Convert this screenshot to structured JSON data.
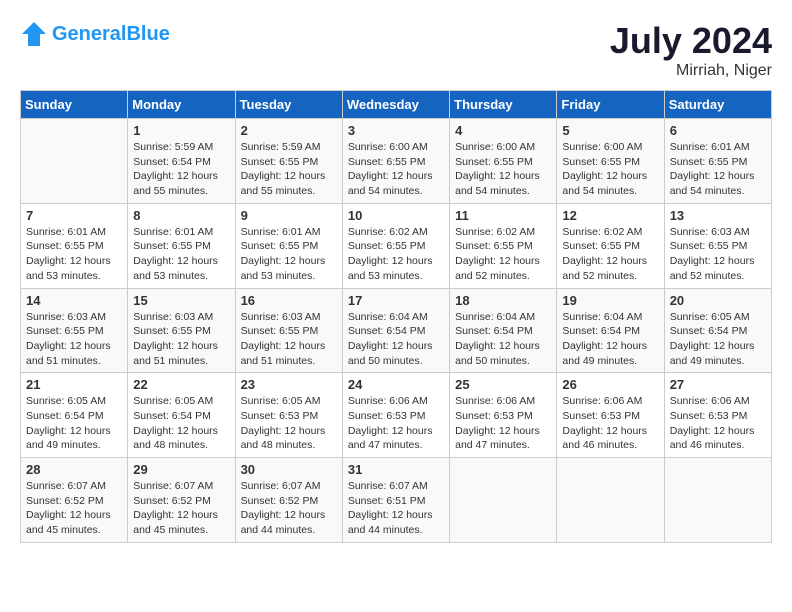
{
  "header": {
    "logo_text_general": "General",
    "logo_text_blue": "Blue",
    "month_year": "July 2024",
    "location": "Mirriah, Niger"
  },
  "weekdays": [
    "Sunday",
    "Monday",
    "Tuesday",
    "Wednesday",
    "Thursday",
    "Friday",
    "Saturday"
  ],
  "weeks": [
    [
      {
        "day": "",
        "info": ""
      },
      {
        "day": "1",
        "info": "Sunrise: 5:59 AM\nSunset: 6:54 PM\nDaylight: 12 hours\nand 55 minutes."
      },
      {
        "day": "2",
        "info": "Sunrise: 5:59 AM\nSunset: 6:55 PM\nDaylight: 12 hours\nand 55 minutes."
      },
      {
        "day": "3",
        "info": "Sunrise: 6:00 AM\nSunset: 6:55 PM\nDaylight: 12 hours\nand 54 minutes."
      },
      {
        "day": "4",
        "info": "Sunrise: 6:00 AM\nSunset: 6:55 PM\nDaylight: 12 hours\nand 54 minutes."
      },
      {
        "day": "5",
        "info": "Sunrise: 6:00 AM\nSunset: 6:55 PM\nDaylight: 12 hours\nand 54 minutes."
      },
      {
        "day": "6",
        "info": "Sunrise: 6:01 AM\nSunset: 6:55 PM\nDaylight: 12 hours\nand 54 minutes."
      }
    ],
    [
      {
        "day": "7",
        "info": "Sunrise: 6:01 AM\nSunset: 6:55 PM\nDaylight: 12 hours\nand 53 minutes."
      },
      {
        "day": "8",
        "info": "Sunrise: 6:01 AM\nSunset: 6:55 PM\nDaylight: 12 hours\nand 53 minutes."
      },
      {
        "day": "9",
        "info": "Sunrise: 6:01 AM\nSunset: 6:55 PM\nDaylight: 12 hours\nand 53 minutes."
      },
      {
        "day": "10",
        "info": "Sunrise: 6:02 AM\nSunset: 6:55 PM\nDaylight: 12 hours\nand 53 minutes."
      },
      {
        "day": "11",
        "info": "Sunrise: 6:02 AM\nSunset: 6:55 PM\nDaylight: 12 hours\nand 52 minutes."
      },
      {
        "day": "12",
        "info": "Sunrise: 6:02 AM\nSunset: 6:55 PM\nDaylight: 12 hours\nand 52 minutes."
      },
      {
        "day": "13",
        "info": "Sunrise: 6:03 AM\nSunset: 6:55 PM\nDaylight: 12 hours\nand 52 minutes."
      }
    ],
    [
      {
        "day": "14",
        "info": "Sunrise: 6:03 AM\nSunset: 6:55 PM\nDaylight: 12 hours\nand 51 minutes."
      },
      {
        "day": "15",
        "info": "Sunrise: 6:03 AM\nSunset: 6:55 PM\nDaylight: 12 hours\nand 51 minutes."
      },
      {
        "day": "16",
        "info": "Sunrise: 6:03 AM\nSunset: 6:55 PM\nDaylight: 12 hours\nand 51 minutes."
      },
      {
        "day": "17",
        "info": "Sunrise: 6:04 AM\nSunset: 6:54 PM\nDaylight: 12 hours\nand 50 minutes."
      },
      {
        "day": "18",
        "info": "Sunrise: 6:04 AM\nSunset: 6:54 PM\nDaylight: 12 hours\nand 50 minutes."
      },
      {
        "day": "19",
        "info": "Sunrise: 6:04 AM\nSunset: 6:54 PM\nDaylight: 12 hours\nand 49 minutes."
      },
      {
        "day": "20",
        "info": "Sunrise: 6:05 AM\nSunset: 6:54 PM\nDaylight: 12 hours\nand 49 minutes."
      }
    ],
    [
      {
        "day": "21",
        "info": "Sunrise: 6:05 AM\nSunset: 6:54 PM\nDaylight: 12 hours\nand 49 minutes."
      },
      {
        "day": "22",
        "info": "Sunrise: 6:05 AM\nSunset: 6:54 PM\nDaylight: 12 hours\nand 48 minutes."
      },
      {
        "day": "23",
        "info": "Sunrise: 6:05 AM\nSunset: 6:53 PM\nDaylight: 12 hours\nand 48 minutes."
      },
      {
        "day": "24",
        "info": "Sunrise: 6:06 AM\nSunset: 6:53 PM\nDaylight: 12 hours\nand 47 minutes."
      },
      {
        "day": "25",
        "info": "Sunrise: 6:06 AM\nSunset: 6:53 PM\nDaylight: 12 hours\nand 47 minutes."
      },
      {
        "day": "26",
        "info": "Sunrise: 6:06 AM\nSunset: 6:53 PM\nDaylight: 12 hours\nand 46 minutes."
      },
      {
        "day": "27",
        "info": "Sunrise: 6:06 AM\nSunset: 6:53 PM\nDaylight: 12 hours\nand 46 minutes."
      }
    ],
    [
      {
        "day": "28",
        "info": "Sunrise: 6:07 AM\nSunset: 6:52 PM\nDaylight: 12 hours\nand 45 minutes."
      },
      {
        "day": "29",
        "info": "Sunrise: 6:07 AM\nSunset: 6:52 PM\nDaylight: 12 hours\nand 45 minutes."
      },
      {
        "day": "30",
        "info": "Sunrise: 6:07 AM\nSunset: 6:52 PM\nDaylight: 12 hours\nand 44 minutes."
      },
      {
        "day": "31",
        "info": "Sunrise: 6:07 AM\nSunset: 6:51 PM\nDaylight: 12 hours\nand 44 minutes."
      },
      {
        "day": "",
        "info": ""
      },
      {
        "day": "",
        "info": ""
      },
      {
        "day": "",
        "info": ""
      }
    ]
  ]
}
